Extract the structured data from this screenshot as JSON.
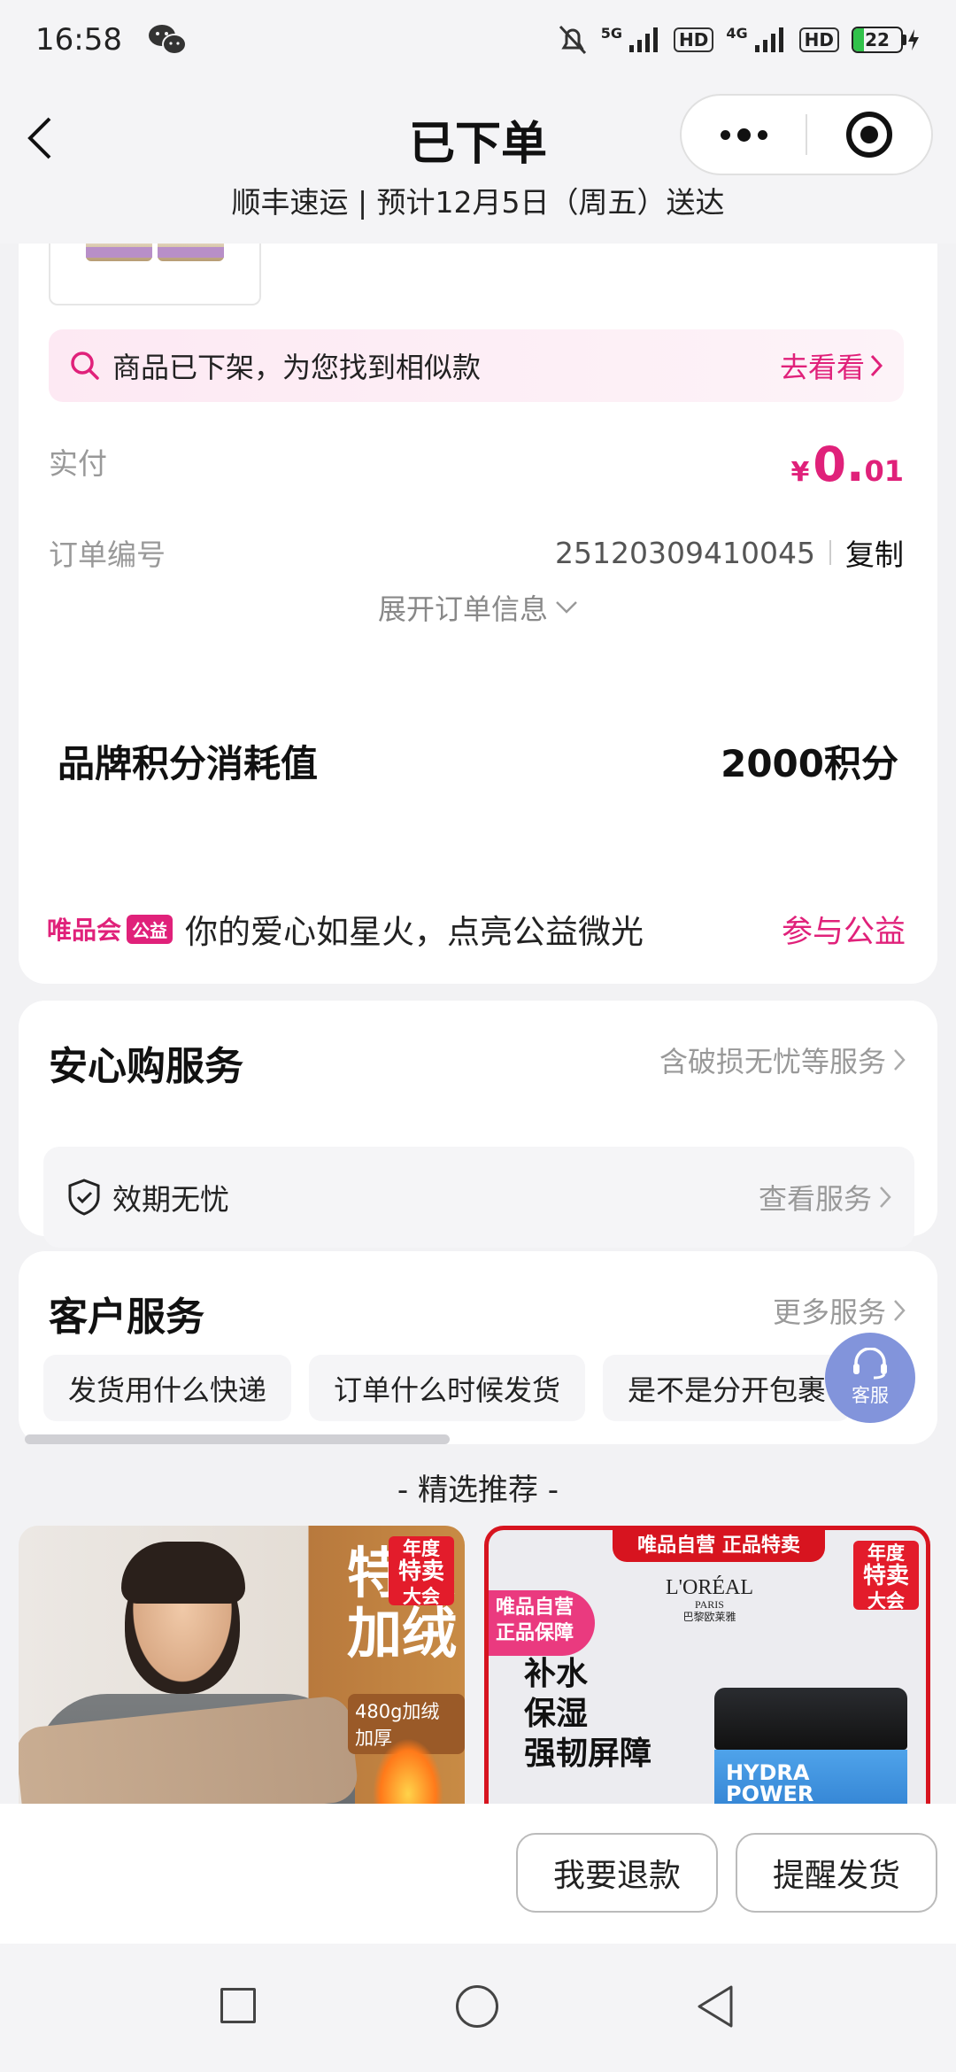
{
  "status_bar": {
    "time": "16:58",
    "network_1": "5G",
    "hd_1": "HD",
    "network_2": "4G",
    "hd_2": "HD",
    "battery": "22",
    "battery_level": 0.22
  },
  "header": {
    "title": "已下单",
    "delivery": "顺丰速运 | 预计12月5日（周五）送达"
  },
  "order": {
    "similar_notice": "商品已下架，为您找到相似款",
    "similar_link": "去看看",
    "paid_label": "实付",
    "paid_currency": "¥",
    "paid_integer": "0.",
    "paid_decimal": "01",
    "order_no_label": "订单编号",
    "order_no": "25120309410045",
    "copy_label": "复制",
    "expand_label": "展开订单信息"
  },
  "points": {
    "label": "品牌积分消耗值",
    "value": "2000积分"
  },
  "charity": {
    "brand": "唯品会",
    "brand_tag": "公益",
    "text": "你的爱心如星火，点亮公益微光",
    "link": "参与公益"
  },
  "service": {
    "title": "安心购服务",
    "more": "含破损无忧等服务",
    "item_name": "效期无忧",
    "item_view": "查看服务"
  },
  "customer_service": {
    "title": "客户服务",
    "more": "更多服务",
    "chips": [
      "发货用什么快递",
      "订单什么时候发货",
      "是不是分开包裹"
    ],
    "float_label": "客服"
  },
  "recommend": {
    "title": "-  精选推荐  -",
    "left": {
      "headline": "特惠加绒",
      "spec": "480g加绒加厚",
      "badge_top": "年度",
      "badge_mid": "特卖",
      "badge_bottom": "大会"
    },
    "right": {
      "banner": "唯品自营 正品特卖",
      "flag": "唯品自营正品保障",
      "brand": "L'ORÉAL",
      "brand_sub": "PARIS",
      "brand_cn": "巴黎欧莱雅",
      "slogan_1": "补水",
      "slogan_2": "保湿",
      "slogan_3": "强韧屏障",
      "jar_1": "HYDRA",
      "jar_2": "POWER",
      "badge_top": "年度",
      "badge_mid": "特卖",
      "badge_bottom": "大会"
    }
  },
  "actions": {
    "refund": "我要退款",
    "remind": "提醒发货"
  },
  "colors": {
    "accent": "#e0217a",
    "float_button": "#7c8fda",
    "badge_red": "#e31c2b"
  }
}
